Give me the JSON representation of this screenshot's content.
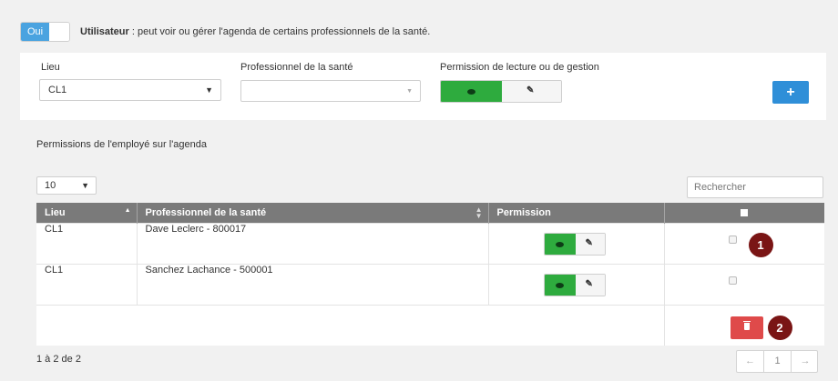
{
  "toggle": {
    "label": "Oui"
  },
  "user": {
    "label": "Utilisateur",
    "description": " : peut voir ou gérer l'agenda de certains professionnels de la santé."
  },
  "filter": {
    "lieu_label": "Lieu",
    "lieu_value": "CL1",
    "pro_label": "Professionnel de la santé",
    "pro_value": "",
    "perm_label": "Permission de lecture ou de gestion",
    "add_label": "+"
  },
  "perms": {
    "title": "Permissions de l'employé sur l'agenda",
    "page_length": "10",
    "search_placeholder": "Rechercher",
    "columns": [
      "Lieu",
      "Professionnel de la santé",
      "Permission"
    ],
    "rows": [
      {
        "lieu": "CL1",
        "pro": "Dave Leclerc - 800017",
        "permission": "view"
      },
      {
        "lieu": "CL1",
        "pro": "Sanchez Lachance - 500001",
        "permission": "view"
      }
    ],
    "markers": [
      "1",
      "2"
    ],
    "info": "1 à 2 de 2",
    "pager": {
      "prev": "←",
      "page": "1",
      "next": "→"
    }
  },
  "colors": {
    "accent": "#4aa3e0",
    "view_on": "#2eab3e",
    "add": "#2f8fd8",
    "delete": "#df4a4a",
    "marker": "#7a1515",
    "header": "#7a7a7a"
  },
  "icons": [
    "eye-icon",
    "edit-icon",
    "plus-icon",
    "trash-icon",
    "sort-asc-icon",
    "sort-both-icon",
    "checkbox-icon"
  ]
}
